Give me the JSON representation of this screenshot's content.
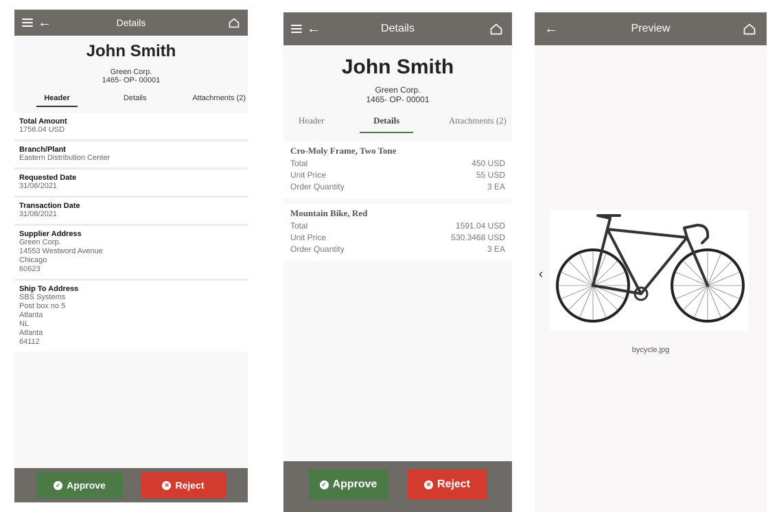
{
  "screens": [
    {
      "title": "Details",
      "person": {
        "name": "John Smith",
        "org": "Green Corp.",
        "id": "1465- OP- 00001"
      },
      "tabs": [
        "Header",
        "Details",
        "Attachments (2)"
      ],
      "active_tab": "Header",
      "fields": [
        {
          "label": "Total Amount",
          "lines": [
            "1756.04 USD"
          ]
        },
        {
          "label": "Branch/Plant",
          "lines": [
            "Eastern Distribution Center"
          ]
        },
        {
          "label": "Requested Date",
          "lines": [
            "31/08/2021"
          ]
        },
        {
          "label": "Transaction Date",
          "lines": [
            "31/08/2021"
          ]
        },
        {
          "label": "Supplier Address",
          "lines": [
            "Green Corp.",
            "14553 Westword Avenue",
            "Chicago",
            "60623"
          ]
        },
        {
          "label": "Ship To Address",
          "lines": [
            "SBS Systems",
            "Post box no 5",
            "Atlanta",
            "NL",
            "Atlanta",
            "64112"
          ]
        }
      ],
      "approve_label": "Approve",
      "reject_label": "Reject"
    },
    {
      "title": "Details",
      "person": {
        "name": "John Smith",
        "org": "Green Corp.",
        "id": "1465- OP- 00001"
      },
      "tabs": [
        "Header",
        "Details",
        "Attachments (2)"
      ],
      "active_tab": "Details",
      "line_items": [
        {
          "title": "Cro-Moly Frame, Two Tone",
          "rows": [
            {
              "label": "Total",
              "value": "450 USD"
            },
            {
              "label": "Unit Price",
              "value": "55 USD"
            },
            {
              "label": "Order Quantity",
              "value": "3 EA"
            }
          ]
        },
        {
          "title": "Mountain Bike, Red",
          "rows": [
            {
              "label": "Total",
              "value": "1591.04 USD"
            },
            {
              "label": "Unit Price",
              "value": "530.3468 USD"
            },
            {
              "label": "Order Quantity",
              "value": "3 EA"
            }
          ]
        }
      ],
      "approve_label": "Approve",
      "reject_label": "Reject"
    },
    {
      "title": "Preview",
      "image_caption": "bycycle.jpg",
      "prev_icon": "chevron-left-icon"
    }
  ],
  "icons": {
    "menu": "hamburger-menu-icon",
    "back": "arrow-left-icon",
    "home": "home-icon"
  },
  "colors": {
    "bar": "#6e6b66",
    "approve": "#4b7a47",
    "reject": "#d23b2e"
  }
}
